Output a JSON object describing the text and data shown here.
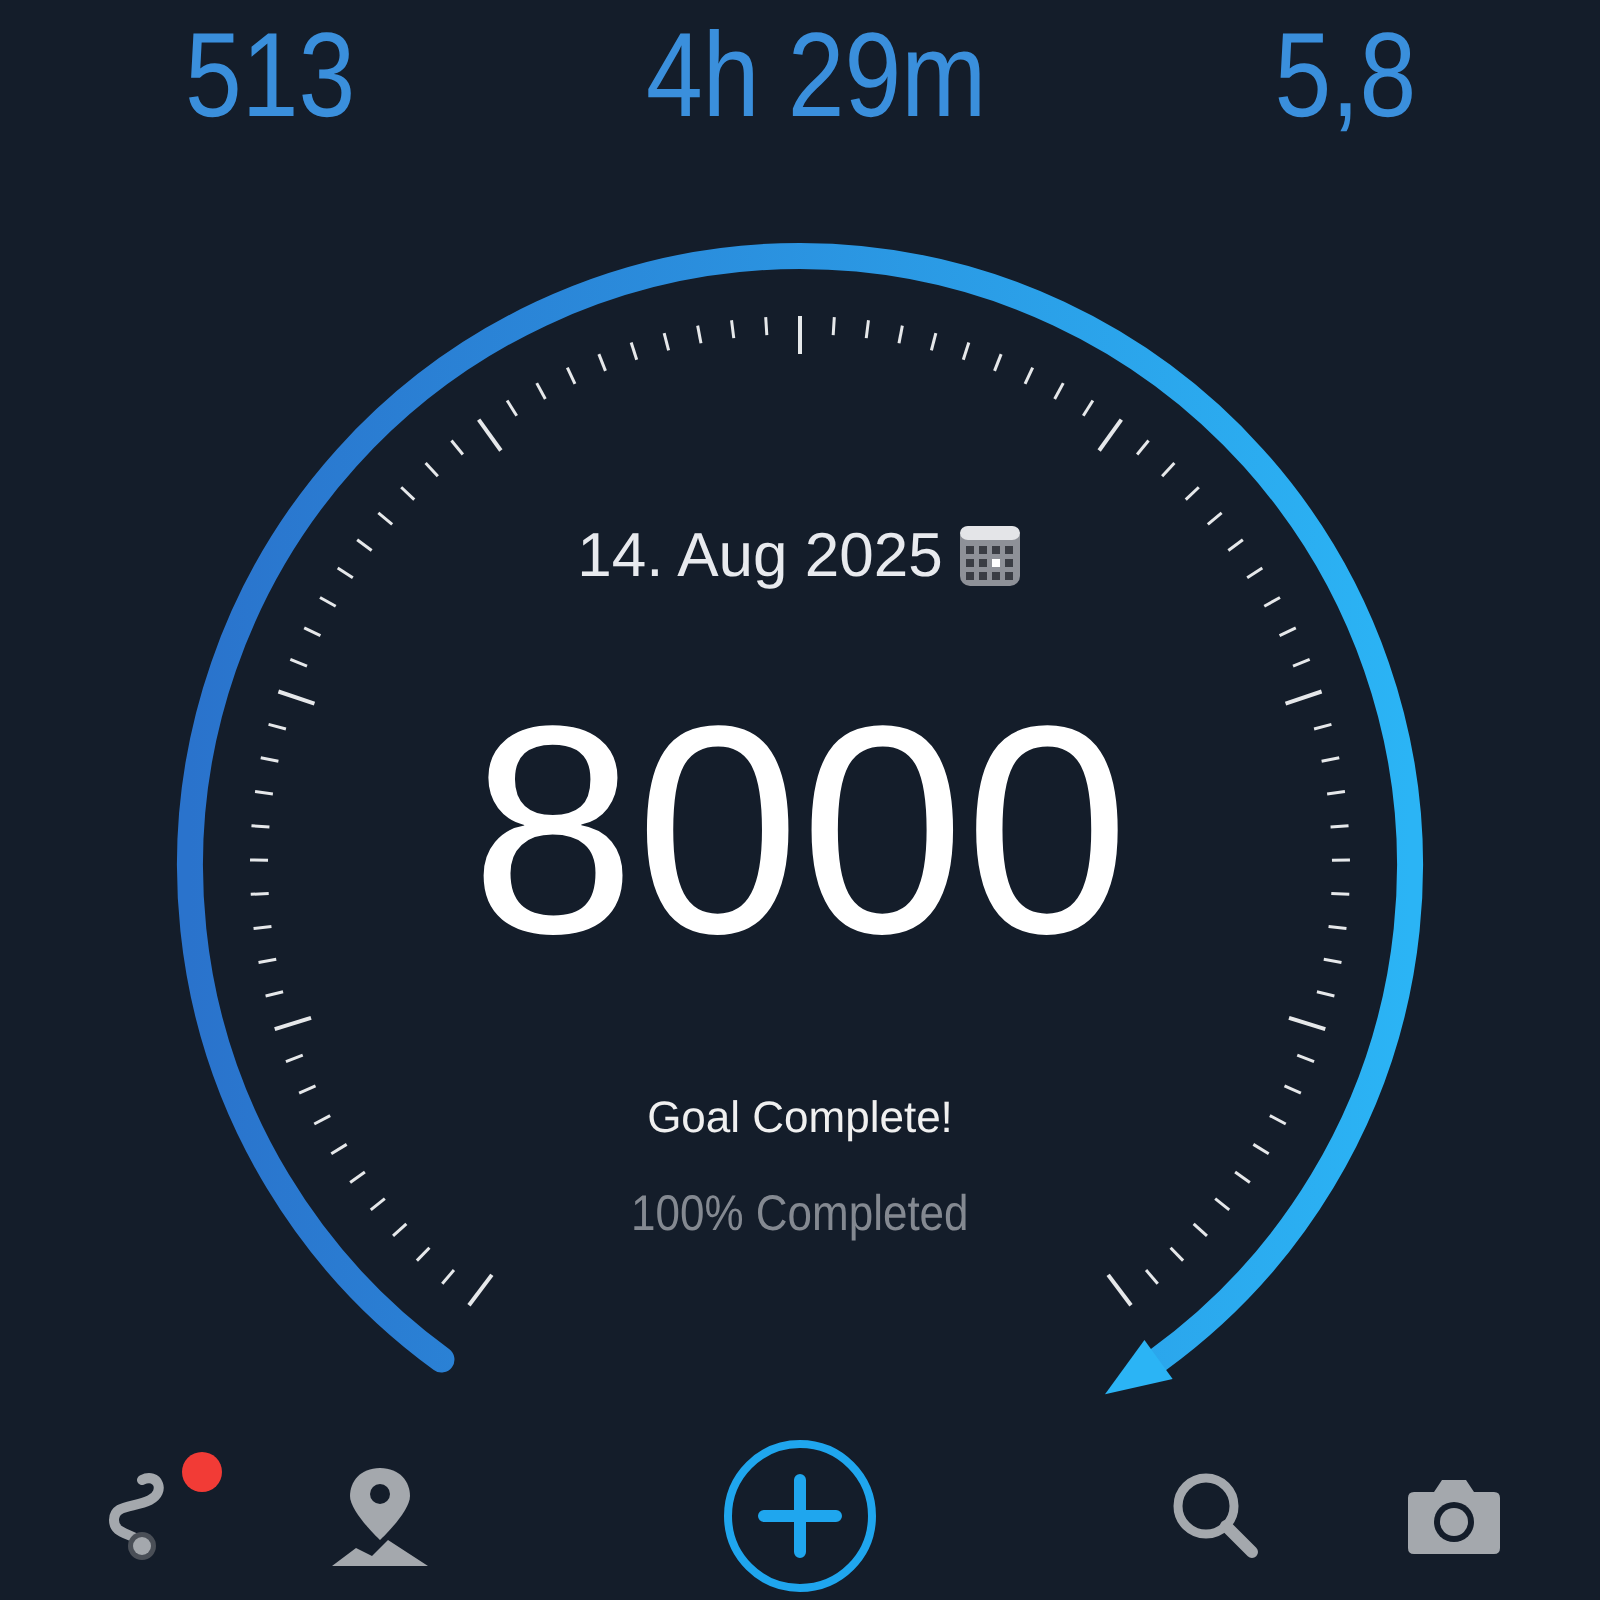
{
  "stats": [
    {
      "value": "513"
    },
    {
      "value": "4h 29m"
    },
    {
      "value": "5,8"
    }
  ],
  "gauge": {
    "date": "14. Aug 2025",
    "steps": "8000",
    "status": "Goal Complete!",
    "percent": "100% Completed"
  },
  "nav": [
    {
      "kind": "route",
      "notification": true
    },
    {
      "kind": "map"
    },
    {
      "kind": "add"
    },
    {
      "kind": "search"
    },
    {
      "kind": "camera"
    }
  ]
}
